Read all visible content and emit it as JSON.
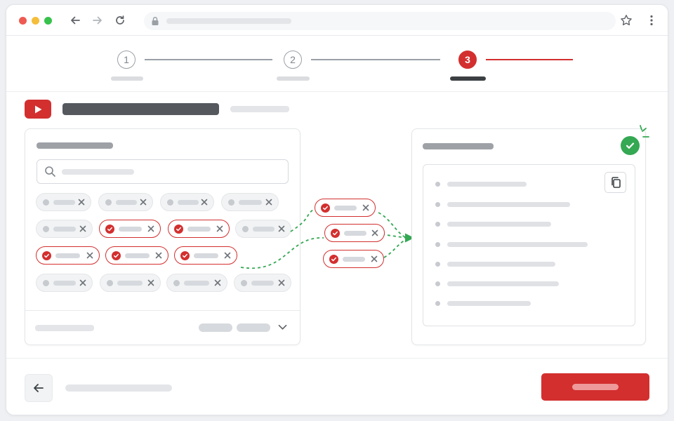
{
  "browser": {
    "icons": [
      "back-arrow-icon",
      "forward-arrow-icon",
      "reload-icon",
      "lock-icon",
      "star-icon",
      "more-vert-icon"
    ],
    "address_text": ""
  },
  "stepper": {
    "steps": [
      {
        "number": "1",
        "state": "completed"
      },
      {
        "number": "2",
        "state": "completed"
      },
      {
        "number": "3",
        "state": "active"
      }
    ],
    "accent_color": "#d32f2f"
  },
  "header": {
    "logo_icon": "youtube-play-icon",
    "brand_color": "#d32f2f"
  },
  "source_panel": {
    "search_icon": "search-icon",
    "chips": [
      {
        "row": 1,
        "selected": false
      },
      {
        "row": 1,
        "selected": false
      },
      {
        "row": 1,
        "selected": false
      },
      {
        "row": 1,
        "selected": false
      },
      {
        "row": 2,
        "selected": false
      },
      {
        "row": 2,
        "selected": true
      },
      {
        "row": 2,
        "selected": true
      },
      {
        "row": 2,
        "selected": false
      },
      {
        "row": 3,
        "selected": true
      },
      {
        "row": 3,
        "selected": true
      },
      {
        "row": 3,
        "selected": true
      },
      {
        "row": 4,
        "selected": false
      },
      {
        "row": 4,
        "selected": false
      },
      {
        "row": 4,
        "selected": false
      },
      {
        "row": 4,
        "selected": false
      }
    ],
    "footer_icon": "chevron-down-icon"
  },
  "transfer": {
    "moving_chips": 3,
    "arrow_color": "#34a853"
  },
  "result_panel": {
    "status_icon": "check-circle-icon",
    "status_color": "#34a853",
    "copy_icon": "copy-icon",
    "list_items": 7
  },
  "footer": {
    "back_icon": "arrow-left-icon",
    "primary_color": "#d32f2f"
  }
}
